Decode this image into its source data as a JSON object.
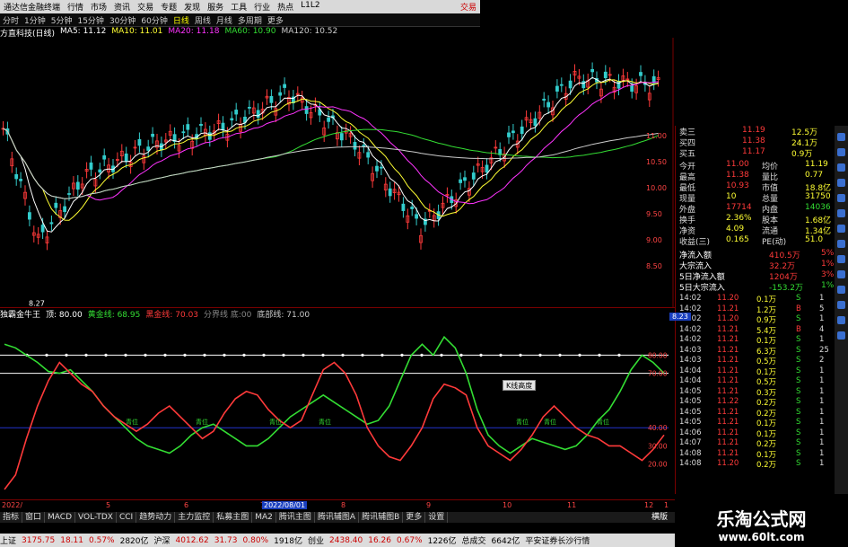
{
  "top_menu": {
    "app_title": "通达信金融终端",
    "items": [
      "行情",
      "市场",
      "资讯",
      "交易",
      "专题",
      "发现",
      "服务",
      "工具",
      "行业",
      "热点",
      "L1L2"
    ],
    "right_label": "交易"
  },
  "period_bar": {
    "items": [
      "分时",
      "1分钟",
      "5分钟",
      "15分钟",
      "30分钟",
      "60分钟",
      "日线",
      "周线",
      "月线",
      "多周期",
      "更多"
    ],
    "active_index": 6
  },
  "ma_legend": {
    "stock_name": "方直科技(日线)",
    "items": [
      {
        "label": "MA5: 11.12",
        "color": "#ffffff"
      },
      {
        "label": "MA10: 11.01",
        "color": "#ffff33"
      },
      {
        "label": "MA20: 11.18",
        "color": "#ff33ff"
      },
      {
        "label": "MA60: 10.90",
        "color": "#33dd33"
      },
      {
        "label": "MA120: 10.52",
        "color": "#cccccc"
      }
    ]
  },
  "price_axis": [
    "11.00",
    "10.50",
    "10.00",
    "9.50",
    "9.00",
    "8.50"
  ],
  "price_marker": "8.23",
  "low_label": "8.27",
  "indicator": {
    "name": "独霸金牛王",
    "items": [
      {
        "label": "顶: 80.00",
        "color": "#ffffff"
      },
      {
        "label": "黄金线: 68.95",
        "color": "#33dd33"
      },
      {
        "label": "黑金线: 70.03",
        "color": "#ff3a3a"
      },
      {
        "label": "分界线 底:00",
        "color": "#888888"
      },
      {
        "label": "底部线: 71.00",
        "color": "#cccccc"
      }
    ],
    "axis": [
      "80.00",
      "70.00",
      "40.00",
      "30.00",
      "20.00"
    ],
    "tooltip": "K线高度",
    "qingwei_label": "青位",
    "chart_data": {
      "type": "line",
      "series": [
        {
          "name": "黄金线",
          "color": "#33dd33",
          "values": [
            86,
            84,
            80,
            76,
            71,
            70,
            72,
            66,
            60,
            52,
            46,
            40,
            34,
            30,
            28,
            26,
            30,
            36,
            40,
            42,
            38,
            34,
            30,
            30,
            34,
            40,
            46,
            50,
            54,
            58,
            54,
            50,
            46,
            42,
            44,
            52,
            66,
            80,
            86,
            80,
            90,
            84,
            70,
            50,
            36,
            30,
            26,
            30,
            34,
            32,
            30,
            28,
            30,
            36,
            44,
            50,
            60,
            72,
            80,
            76,
            70
          ]
        },
        {
          "name": "黑金线",
          "color": "#ff3a3a",
          "values": [
            6,
            14,
            34,
            52,
            66,
            76,
            70,
            64,
            60,
            52,
            46,
            42,
            38,
            42,
            48,
            52,
            46,
            40,
            34,
            38,
            48,
            56,
            60,
            58,
            50,
            44,
            40,
            44,
            58,
            72,
            76,
            70,
            58,
            40,
            30,
            24,
            22,
            30,
            40,
            56,
            64,
            62,
            58,
            40,
            30,
            26,
            22,
            28,
            36,
            46,
            52,
            46,
            40,
            36,
            34,
            30,
            30,
            26,
            22,
            28,
            36
          ]
        }
      ],
      "ylim": [
        0,
        100
      ]
    }
  },
  "date_axis": [
    "2022/",
    "5",
    "6",
    "7",
    "8",
    "9",
    "10",
    "11",
    "12",
    "1"
  ],
  "date_cursor": "2022/08/01",
  "quote": {
    "top_rows": [
      {
        "l": "卖三",
        "v": "11.19",
        "r": "12.5万"
      },
      {
        "l": "买四",
        "v": "11.38",
        "r": "24.1万"
      },
      {
        "l": "买五",
        "v": "11.17",
        "r": "0.9万"
      }
    ],
    "rows": [
      {
        "l": "今开",
        "v": "11.00",
        "m": "均价",
        "r": "11.19"
      },
      {
        "l": "最高",
        "v": "11.38",
        "m": "量比",
        "r": "0.77"
      },
      {
        "l": "最低",
        "v": "10.93",
        "m": "市值",
        "r": "18.8亿"
      },
      {
        "l": "现量",
        "v": "10",
        "m": "总量",
        "r": "31750"
      },
      {
        "l": "外盘",
        "v": "17714",
        "m": "内盘",
        "r": "14036"
      },
      {
        "l": "换手",
        "v": "2.36%",
        "m": "股本",
        "r": "1.68亿"
      },
      {
        "l": "净资",
        "v": "4.09",
        "m": "流通",
        "r": "1.34亿"
      },
      {
        "l": "收益(三)",
        "v": "0.165",
        "m": "PE(动)",
        "r": "51.0"
      }
    ],
    "flow": [
      {
        "l": "净流入额",
        "v": "410.5万",
        "r": "5%"
      },
      {
        "l": "大宗流入",
        "v": "32.2万",
        "r": "1%"
      },
      {
        "l": "5日净流入额",
        "v": "1204万",
        "r": "3%"
      },
      {
        "l": "5日大宗流入",
        "v": "-153.2万",
        "r": "1%"
      }
    ]
  },
  "ticks": [
    {
      "t": "14:02",
      "p": "11.20",
      "v": "0.1万",
      "s": "S",
      "n": "1"
    },
    {
      "t": "14:02",
      "p": "11.21",
      "v": "1.2万",
      "s": "B",
      "n": "5"
    },
    {
      "t": "14:02",
      "p": "11.20",
      "v": "0.9万",
      "s": "S",
      "n": "1"
    },
    {
      "t": "14:02",
      "p": "11.21",
      "v": "5.4万",
      "s": "B",
      "n": "4"
    },
    {
      "t": "14:02",
      "p": "11.21",
      "v": "0.1万",
      "s": "S",
      "n": "1"
    },
    {
      "t": "14:03",
      "p": "11.21",
      "v": "6.3万",
      "s": "S",
      "n": "25"
    },
    {
      "t": "14:03",
      "p": "11.21",
      "v": "0.5万",
      "s": "S",
      "n": "2"
    },
    {
      "t": "14:04",
      "p": "11.21",
      "v": "0.1万",
      "s": "S",
      "n": "1"
    },
    {
      "t": "14:04",
      "p": "11.21",
      "v": "0.5万",
      "s": "S",
      "n": "1"
    },
    {
      "t": "14:05",
      "p": "11.21",
      "v": "0.3万",
      "s": "S",
      "n": "1"
    },
    {
      "t": "14:05",
      "p": "11.22",
      "v": "0.2万",
      "s": "S",
      "n": "1"
    },
    {
      "t": "14:05",
      "p": "11.21",
      "v": "0.2万",
      "s": "S",
      "n": "1"
    },
    {
      "t": "14:05",
      "p": "11.21",
      "v": "0.1万",
      "s": "S",
      "n": "1"
    },
    {
      "t": "14:06",
      "p": "11.21",
      "v": "0.1万",
      "s": "S",
      "n": "1"
    },
    {
      "t": "14:07",
      "p": "11.21",
      "v": "0.2万",
      "s": "S",
      "n": "1"
    },
    {
      "t": "14:08",
      "p": "11.21",
      "v": "0.1万",
      "s": "S",
      "n": "1"
    },
    {
      "t": "14:08",
      "p": "11.20",
      "v": "0.2万",
      "s": "S",
      "n": "1"
    }
  ],
  "bottom_tabs": [
    "指标",
    "窗口",
    "MACD",
    "VOL-TDX",
    "CCI",
    "趋势动力",
    "主力监控",
    "私募主图",
    "MA2",
    "腾讯主图",
    "腾讯辅图A",
    "腾讯辅图B",
    "更多",
    "设置"
  ],
  "right_tab": "横版",
  "status_bar": [
    {
      "label": "上证",
      "color": "#000000"
    },
    {
      "label": "3175.75",
      "color": "#cc0000"
    },
    {
      "label": "18.11",
      "color": "#cc0000"
    },
    {
      "label": "0.57%",
      "color": "#cc0000"
    },
    {
      "label": "2820亿",
      "color": "#000000"
    },
    {
      "label": "沪深",
      "color": "#000000"
    },
    {
      "label": "4012.62",
      "color": "#cc0000"
    },
    {
      "label": "31.73",
      "color": "#cc0000"
    },
    {
      "label": "0.80%",
      "color": "#cc0000"
    },
    {
      "label": "1918亿",
      "color": "#000000"
    },
    {
      "label": "创业",
      "color": "#000000"
    },
    {
      "label": "2438.40",
      "color": "#cc0000"
    },
    {
      "label": "16.26",
      "color": "#cc0000"
    },
    {
      "label": "0.67%",
      "color": "#cc0000"
    },
    {
      "label": "1226亿",
      "color": "#000000"
    },
    {
      "label": "总成交",
      "color": "#000000"
    },
    {
      "label": "6642亿",
      "color": "#000000"
    },
    {
      "label": "平安证券长沙行情",
      "color": "#000000"
    }
  ],
  "watermark": {
    "title": "乐淘公式网",
    "url": "www.60lt.com"
  }
}
